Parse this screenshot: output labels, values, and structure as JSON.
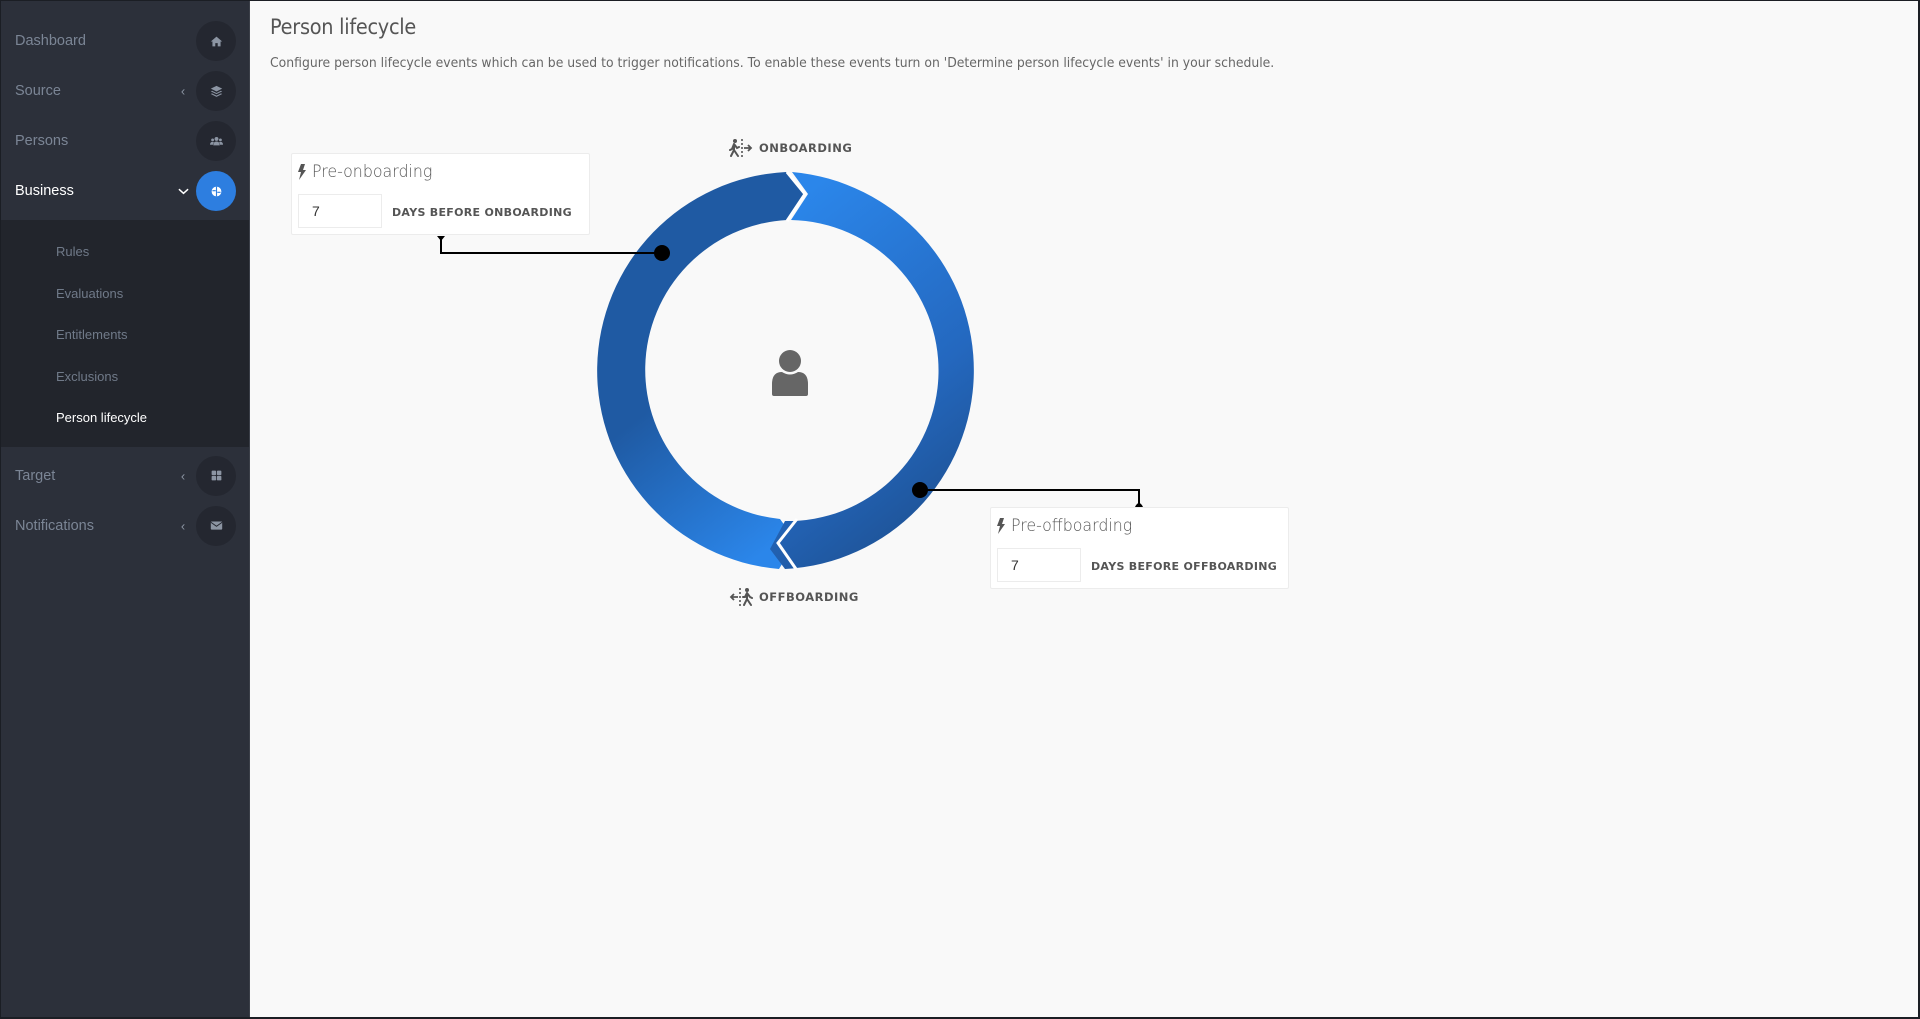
{
  "sidebar": {
    "items": [
      {
        "label": "Dashboard",
        "icon": "home-icon",
        "has_chevron": false,
        "active": false
      },
      {
        "label": "Source",
        "icon": "layers-icon",
        "chevron": "‹",
        "active": false
      },
      {
        "label": "Persons",
        "icon": "users-icon",
        "has_chevron": false,
        "active": false
      },
      {
        "label": "Business",
        "icon": "brain-icon",
        "chevron": "⌄",
        "active": true
      },
      {
        "label": "Target",
        "icon": "grid-icon",
        "chevron": "‹",
        "active": false
      },
      {
        "label": "Notifications",
        "icon": "envelope-icon",
        "chevron": "‹",
        "active": false
      }
    ],
    "business_submenu": [
      {
        "label": "Rules",
        "active": false
      },
      {
        "label": "Evaluations",
        "active": false
      },
      {
        "label": "Entitlements",
        "active": false
      },
      {
        "label": "Exclusions",
        "active": false
      },
      {
        "label": "Person lifecycle",
        "active": true
      }
    ]
  },
  "main": {
    "title": "Person lifecycle",
    "description": "Configure person lifecycle events which can be used to trigger notifications. To enable these events turn on 'Determine person lifecycle events' in your schedule.",
    "phases": {
      "onboarding": "ONBOARDING",
      "offboarding": "OFFBOARDING"
    },
    "events": {
      "pre_onboarding": {
        "title": "Pre-onboarding",
        "days_value": "7",
        "unit_label": "DAYS BEFORE ONBOARDING"
      },
      "pre_offboarding": {
        "title": "Pre-offboarding",
        "days_value": "7",
        "unit_label": "DAYS BEFORE OFFBOARDING"
      }
    },
    "center_icon": "person-icon"
  },
  "colors": {
    "accent": "#2d7ee0",
    "ring_dark": "#1d4f8f",
    "ring_light": "#2b86ea",
    "sidebar_bg": "#2c303a",
    "submenu_bg": "#22252c"
  }
}
